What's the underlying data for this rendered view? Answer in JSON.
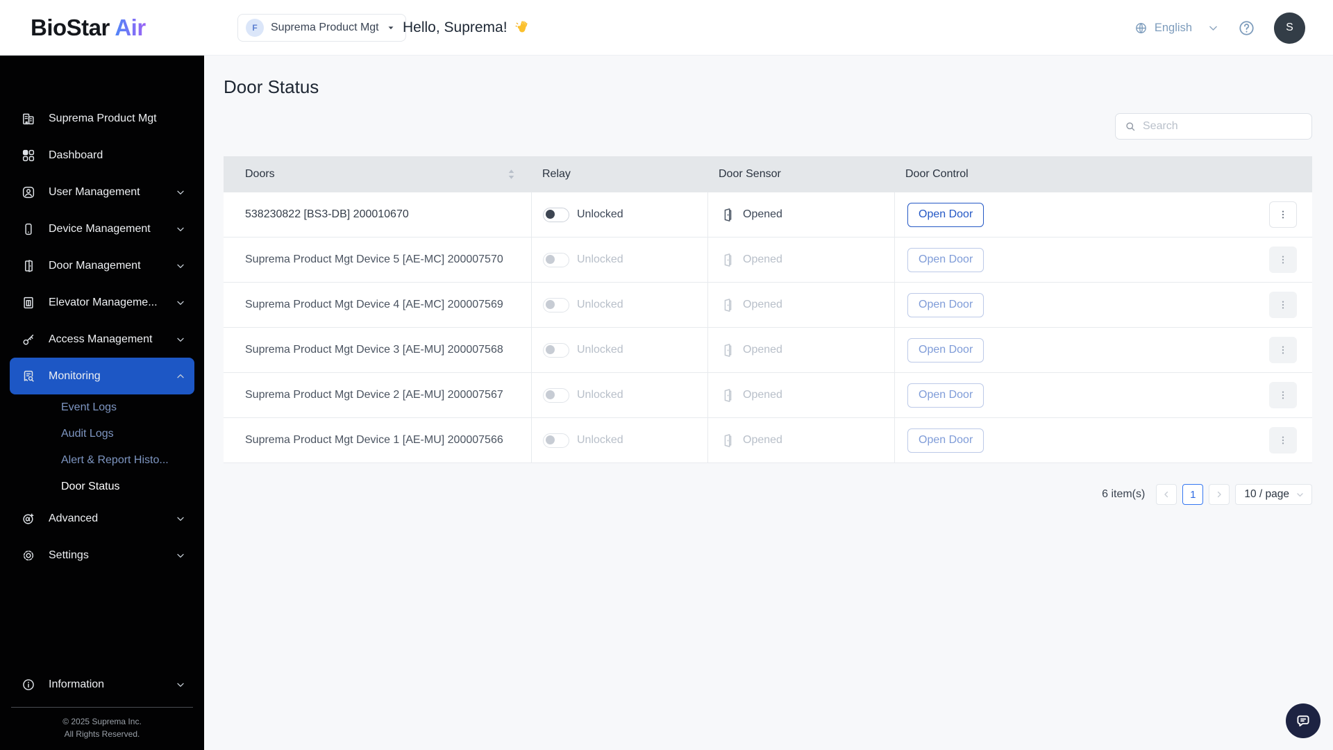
{
  "app": {
    "logo_primary": "BioStar",
    "logo_accent": "Air"
  },
  "header": {
    "org_selector": {
      "badge": "F",
      "label": "Suprema Product Mgt"
    },
    "greeting_text": "Hello, Suprema!",
    "greeting_emoji": "👋",
    "language": "English",
    "avatar_initial": "S"
  },
  "sidebar": {
    "items": [
      {
        "icon": "building-icon",
        "label": "Suprema Product Mgt"
      },
      {
        "icon": "dashboard-icon",
        "label": "Dashboard"
      },
      {
        "icon": "user-icon",
        "label": "User Management",
        "chevron": "down"
      },
      {
        "icon": "device-icon",
        "label": "Device Management",
        "chevron": "down"
      },
      {
        "icon": "door-icon",
        "label": "Door Management",
        "chevron": "down"
      },
      {
        "icon": "elevator-icon",
        "label": "Elevator Manageme...",
        "chevron": "down"
      },
      {
        "icon": "key-icon",
        "label": "Access Management",
        "chevron": "down"
      },
      {
        "icon": "monitoring-icon",
        "label": "Monitoring",
        "chevron": "up",
        "active": true
      },
      {
        "label": "Event Logs",
        "sub": true
      },
      {
        "label": "Audit Logs",
        "sub": true
      },
      {
        "label": "Alert & Report Histo...",
        "sub": true
      },
      {
        "label": "Door Status",
        "sub": true,
        "subActive": true
      },
      {
        "icon": "advanced-icon",
        "label": "Advanced",
        "chevron": "down"
      },
      {
        "icon": "settings-icon",
        "label": "Settings",
        "chevron": "down"
      }
    ],
    "info_item": {
      "icon": "info-icon",
      "label": "Information",
      "chevron": "down"
    },
    "footer_line1": "© 2025 Suprema Inc.",
    "footer_line2": "All Rights Reserved."
  },
  "main": {
    "title": "Door Status",
    "search_placeholder": "Search",
    "table": {
      "columns": [
        "Doors",
        "Relay",
        "Door Sensor",
        "Door Control"
      ],
      "rows": [
        {
          "door": "538230822 [BS3-DB] 200010670",
          "relay": "Unlocked",
          "sensor": "Opened",
          "action": "Open Door",
          "active": true
        },
        {
          "door": "Suprema Product Mgt Device 5 [AE-MC] 200007570",
          "relay": "Unlocked",
          "sensor": "Opened",
          "action": "Open Door",
          "active": false
        },
        {
          "door": "Suprema Product Mgt Device 4 [AE-MC] 200007569",
          "relay": "Unlocked",
          "sensor": "Opened",
          "action": "Open Door",
          "active": false
        },
        {
          "door": "Suprema Product Mgt Device 3 [AE-MU] 200007568",
          "relay": "Unlocked",
          "sensor": "Opened",
          "action": "Open Door",
          "active": false
        },
        {
          "door": "Suprema Product Mgt Device 2 [AE-MU] 200007567",
          "relay": "Unlocked",
          "sensor": "Opened",
          "action": "Open Door",
          "active": false
        },
        {
          "door": "Suprema Product Mgt Device 1 [AE-MU] 200007566",
          "relay": "Unlocked",
          "sensor": "Opened",
          "action": "Open Door",
          "active": false
        }
      ]
    },
    "pagination": {
      "items_label": "6 item(s)",
      "current_page": "1",
      "page_size": "10 / page"
    }
  },
  "colors": {
    "sidebar_bg": "#020203",
    "sidebar_active_blue": "#1d57c5",
    "sidebar_subitem_text": "#7e96c2",
    "accent_button_blue": "#2458c5",
    "pagination_active_blue": "#3477f2",
    "logo_gradient_start": "#4f86f7",
    "logo_gradient_end": "#9a63f5",
    "table_header_bg": "#e4e7ea",
    "header_icon_blue_gray": "#7d9cbc",
    "avatar_bg": "#333d47",
    "chat_fab_bg": "#1d2342",
    "page_bg": "#f7f8fa"
  }
}
